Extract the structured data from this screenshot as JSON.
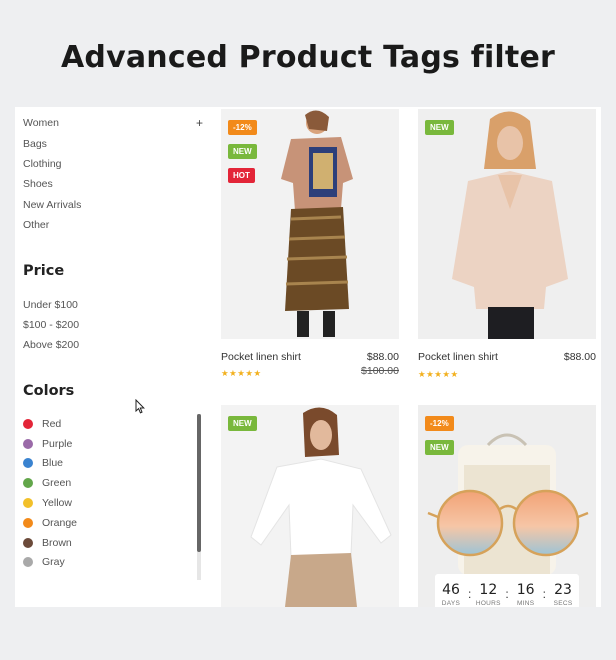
{
  "page": {
    "title": "Advanced Product Tags filter"
  },
  "sidebar": {
    "categories": [
      {
        "label": "Women",
        "expand": "+"
      },
      {
        "label": "Bags"
      },
      {
        "label": "Clothing"
      },
      {
        "label": "Shoes"
      },
      {
        "label": "New Arrivals"
      },
      {
        "label": "Other"
      }
    ],
    "price_title": "Price",
    "prices": [
      "Under $100",
      "$100 - $200",
      "Above $200"
    ],
    "colors_title": "Colors",
    "colors": [
      {
        "label": "Red",
        "hex": "#e32538"
      },
      {
        "label": "Purple",
        "hex": "#9a6aa8"
      },
      {
        "label": "Blue",
        "hex": "#3a83d0"
      },
      {
        "label": "Green",
        "hex": "#62a64a"
      },
      {
        "label": "Yellow",
        "hex": "#f2c02a"
      },
      {
        "label": "Orange",
        "hex": "#f28a1a"
      },
      {
        "label": "Brown",
        "hex": "#6b4a3a"
      },
      {
        "label": "Gray",
        "hex": "#a9a9a9"
      }
    ]
  },
  "products": [
    {
      "name": "Pocket linen shirt",
      "price": "$88.00",
      "old_price": "$100.00",
      "rating": "★★★★★",
      "tags": [
        {
          "text": "-12%",
          "color": "orange"
        },
        {
          "text": "NEW",
          "color": "green"
        },
        {
          "text": "HOT",
          "color": "red"
        }
      ]
    },
    {
      "name": "Pocket linen shirt",
      "price": "$88.00",
      "rating": "★★★★★",
      "tags": [
        {
          "text": "NEW",
          "color": "green"
        }
      ]
    },
    {
      "tags": [
        {
          "text": "NEW",
          "color": "green"
        }
      ]
    },
    {
      "tags": [
        {
          "text": "-12%",
          "color": "orange"
        },
        {
          "text": "NEW",
          "color": "green"
        }
      ],
      "countdown": {
        "days": "46",
        "hours": "12",
        "mins": "16",
        "secs": "23",
        "days_label": "DAYS",
        "hours_label": "HOURS",
        "mins_label": "MINS",
        "secs_label": "SECS"
      }
    }
  ]
}
